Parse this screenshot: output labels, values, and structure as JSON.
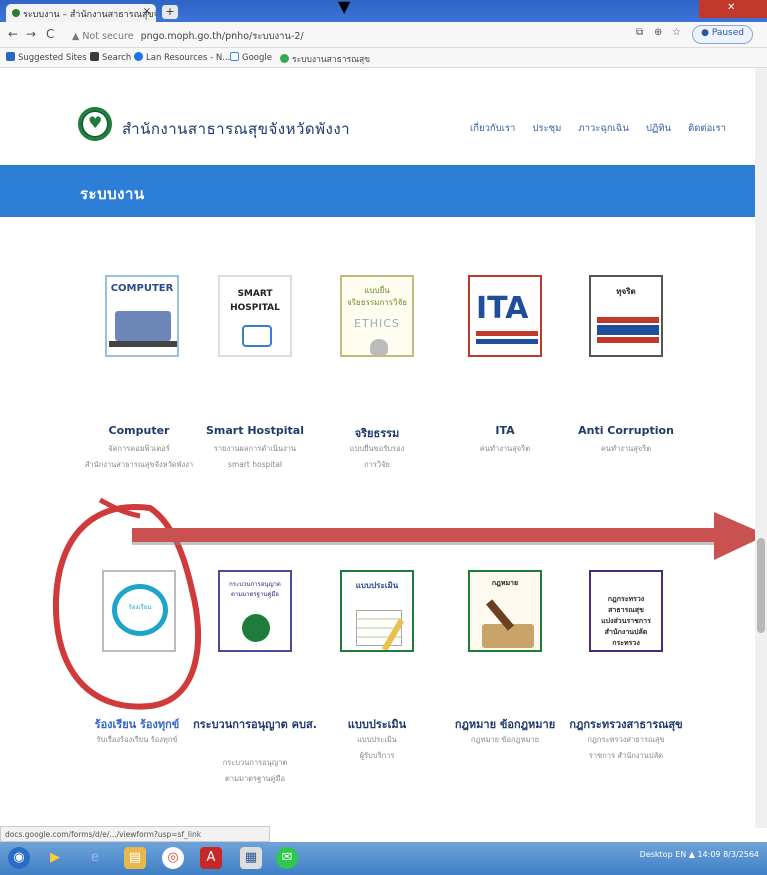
{
  "browser": {
    "tab_title": "ระบบงาน – สำนักงานสาธารณสุขจั...",
    "new_tab": "+",
    "close": "×",
    "url_warning": "▲ Not secure",
    "url": "pngo.moph.go.th/pnho/ระบบงาน-2/",
    "profile": "Paused",
    "bookmarks": [
      "Suggested Sites",
      "Search",
      "Lan Resources - N...",
      "Google",
      "ระบบงานสาธารณสุข"
    ],
    "status_url": "docs.google.com/forms/d/e/.../viewform?usp=sf_link"
  },
  "site": {
    "name": "สำนักงานสาธารณสุขจังหวัดพังงา",
    "nav": [
      "เกี่ยวกับเรา",
      "ประชุม",
      "ภาวะฉุกเฉิน",
      "ปฏิทิน",
      "ติดต่อเรา"
    ],
    "banner_title": "ระบบงาน"
  },
  "cards_row1": [
    {
      "title": "Computer",
      "sub1": "จัดการคอมพิวเตอร์",
      "sub2": "สำนักงานสาธารณสุขจังหวัดพังงา",
      "thumb": "COMPUTER"
    },
    {
      "title": "Smart Hostpital",
      "sub1": "รายงานผลการดำเนินงาน",
      "sub2": "smart hospital",
      "thumb": "SMART HOSPITAL"
    },
    {
      "title": "จริยธรรม",
      "sub1": "แบบยื่นขอรับรอง",
      "sub2": "การวิจัย",
      "thumb": "ETHICS"
    },
    {
      "title": "ITA",
      "sub1": "คนทำงานสุจริต",
      "sub2": "",
      "thumb": "ITA"
    },
    {
      "title": "Anti Corruption",
      "sub1": "คนทำงานสุจริต",
      "sub2": "",
      "thumb": "ทุจริต"
    }
  ],
  "cards_row2": [
    {
      "title": "ร้องเรียน ร้องทุกข์",
      "sub1": "รับเรื่องร้องเรียน ร้องทุกข์",
      "sub2": "",
      "thumb": "ร้องเรียน"
    },
    {
      "title": "กระบวนการอนุญาต คบส.",
      "sub1": "กระบวนการอนุญาต",
      "sub2": "ตามมาตรฐานคู่มือ",
      "thumb": "คบส."
    },
    {
      "title": "แบบประเมิน",
      "sub1": "แบบประเมิน",
      "sub2": "ผู้รับบริการ",
      "thumb": "แบบประเมิน"
    },
    {
      "title": "กฎหมาย ข้อกฎหมาย",
      "sub1": "กฎหมาย ข้อกฎหมาย",
      "sub2": "",
      "thumb": "กฎหมาย"
    },
    {
      "title": "กฎกระทรวงสาธารณสุข",
      "sub1": "กฎกระทรวงสาธารณสุข",
      "sub2": "ราชการ สำนักงานปลัด",
      "thumb": "กฎกระทรวง"
    }
  ],
  "taskbar": {
    "tray": "Desktop  EN  ▲  14:09  8/3/2564"
  },
  "colors": {
    "banner": "#2d7ed6",
    "annotation": "#d03a3a",
    "arrow": "#c9514f"
  }
}
